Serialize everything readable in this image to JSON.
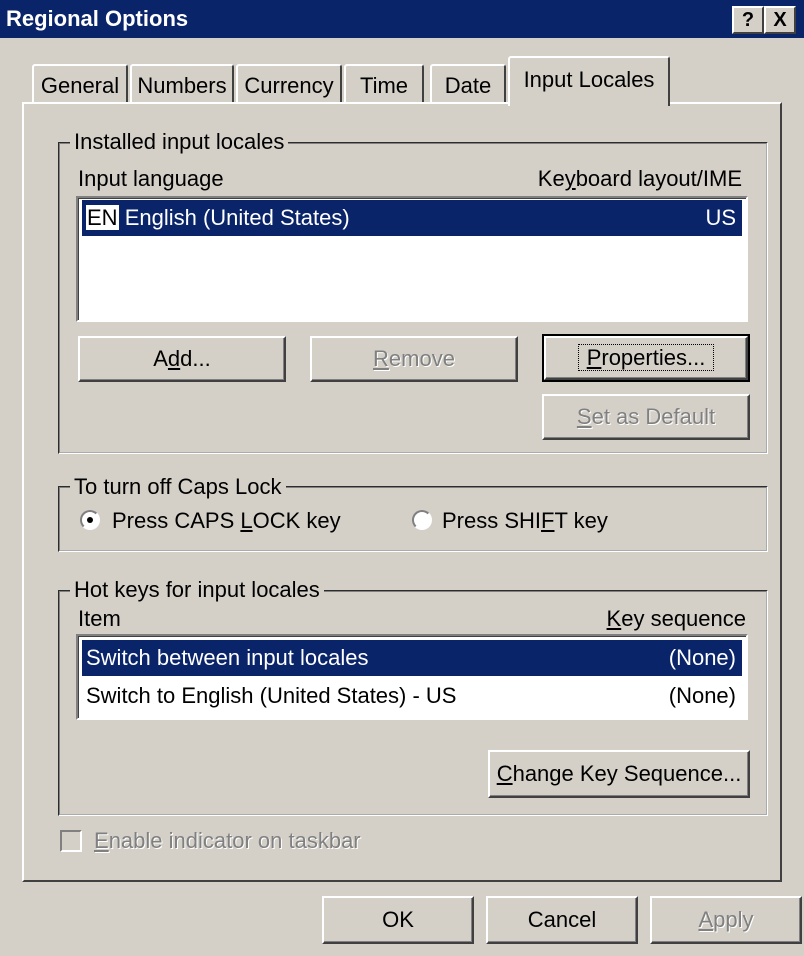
{
  "window": {
    "title": "Regional Options",
    "help_btn": "?",
    "close_btn": "X"
  },
  "tabs": [
    "General",
    "Numbers",
    "Currency",
    "Time",
    "Date",
    "Input Locales"
  ],
  "installed": {
    "group_label": "Installed input locales",
    "col_language": "Input language",
    "col_layout": "Keyboard layout/IME",
    "items": [
      {
        "badge": "EN",
        "language": "English (United States)",
        "layout": "US",
        "selected": true
      }
    ],
    "add_btn": "Add...",
    "remove_btn": "Remove",
    "properties_btn": "Properties...",
    "default_btn": "Set as Default"
  },
  "capslock": {
    "group_label": "To turn off Caps Lock",
    "option_caps": "Press CAPS LOCK key",
    "option_shift": "Press SHIFT key",
    "selected": "caps"
  },
  "hotkeys": {
    "group_label": "Hot keys for input locales",
    "col_item": "Item",
    "col_seq": "Key sequence",
    "rows": [
      {
        "item": "Switch between input locales",
        "seq": "(None)",
        "selected": true
      },
      {
        "item": "Switch to English (United States) - US",
        "seq": "(None)",
        "selected": false
      }
    ],
    "change_btn": "Change Key Sequence..."
  },
  "indicator": {
    "label": "Enable indicator on taskbar",
    "checked": false
  },
  "footer": {
    "ok": "OK",
    "cancel": "Cancel",
    "apply": "Apply"
  }
}
